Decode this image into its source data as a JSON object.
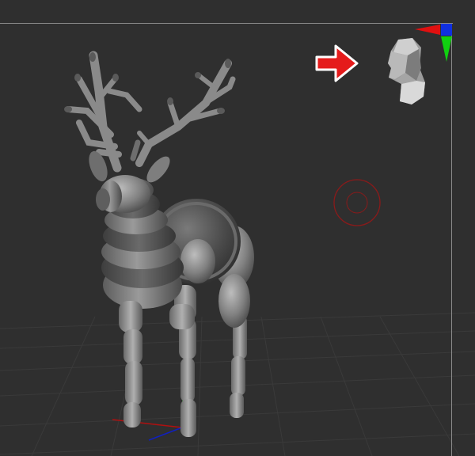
{
  "viewport": {
    "background": "#2f2f2f",
    "frame_color": "#8a8a8a",
    "grid_color": "#3a3a3a"
  },
  "navigation_gizmo": {
    "icon": "head-orientation-icon",
    "axis_colors": {
      "x": "#e01010",
      "y": "#10d010",
      "z": "#1020e0"
    }
  },
  "annotation": {
    "icon": "right-arrow-icon",
    "fill": "#e51b1b",
    "outline": "#ffffff"
  },
  "brush_cursor": {
    "icon": "brush-circle-icon",
    "color": "#8a1a1a"
  },
  "model": {
    "icon": "deer-model-icon",
    "base_color": "#7a7a7a"
  },
  "floor_gizmo": {
    "icon": "floor-axis-icon",
    "axis_colors": {
      "x": "#b01010",
      "y": "#10b010",
      "z": "#1020c0"
    }
  }
}
